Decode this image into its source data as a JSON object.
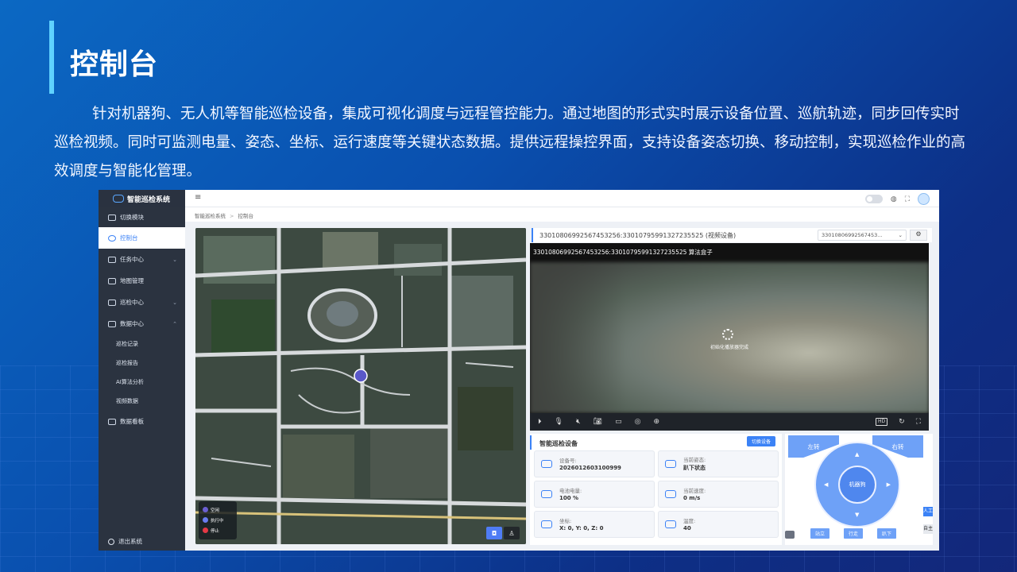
{
  "slide": {
    "title": "控制台",
    "intro": "针对机器狗、无人机等智能巡检设备，集成可视化调度与远程管控能力。通过地图的形式实时展示设备位置、巡航轨迹，同步回传实时巡检视频。同时可监测电量、姿态、坐标、运行速度等关键状态数据。提供远程操控界面，支持设备姿态切换、移动控制，实现巡检作业的高效调度与智能化管理。"
  },
  "app": {
    "name": "智能巡检系统",
    "sidebar": {
      "items": [
        {
          "label": "切换模块"
        },
        {
          "label": "控制台"
        },
        {
          "label": "任务中心"
        },
        {
          "label": "地图管理"
        },
        {
          "label": "巡检中心"
        },
        {
          "label": "数据中心"
        }
      ],
      "sub_items": [
        {
          "label": "巡检记录"
        },
        {
          "label": "巡检报告"
        },
        {
          "label": "AI算法分析"
        },
        {
          "label": "视频数据"
        }
      ],
      "board": "数据看板",
      "logout": "退出系统"
    },
    "breadcrumb": [
      "智能巡检系统",
      "控制台"
    ],
    "map_legend": [
      {
        "label": "空闲",
        "color": "#6b5fd1"
      },
      {
        "label": "执行中",
        "color": "#6a7cf0"
      },
      {
        "label": "停止",
        "color": "#e53945"
      }
    ],
    "video": {
      "header": "33010806992567453256:33010795991327235525 (视频设备)",
      "select_value": "33010806992567453...",
      "overlay_title": "33010806992567453256:33010795991327235525    算法盒子",
      "loading": "初始化播放器完成",
      "hd": "HD"
    },
    "device": {
      "title": "智能巡检设备",
      "switch_btn": "切换设备",
      "cards": [
        {
          "label": "设备号:",
          "value": "2026012603100999"
        },
        {
          "label": "当前姿态:",
          "value": "趴下状态"
        },
        {
          "label": "电池电量:",
          "value": "100 %"
        },
        {
          "label": "当前速度:",
          "value": "0 m/s"
        },
        {
          "label": "坐标:",
          "value": "X: 0, Y: 0, Z: 0"
        },
        {
          "label": "温度:",
          "value": "40"
        }
      ]
    },
    "control": {
      "left_turn": "左转",
      "right_turn": "右转",
      "center": "机器狗",
      "modes": [
        "站立",
        "行走",
        "趴下"
      ],
      "tab_manual": "人工",
      "tab_auto": "自主"
    }
  }
}
